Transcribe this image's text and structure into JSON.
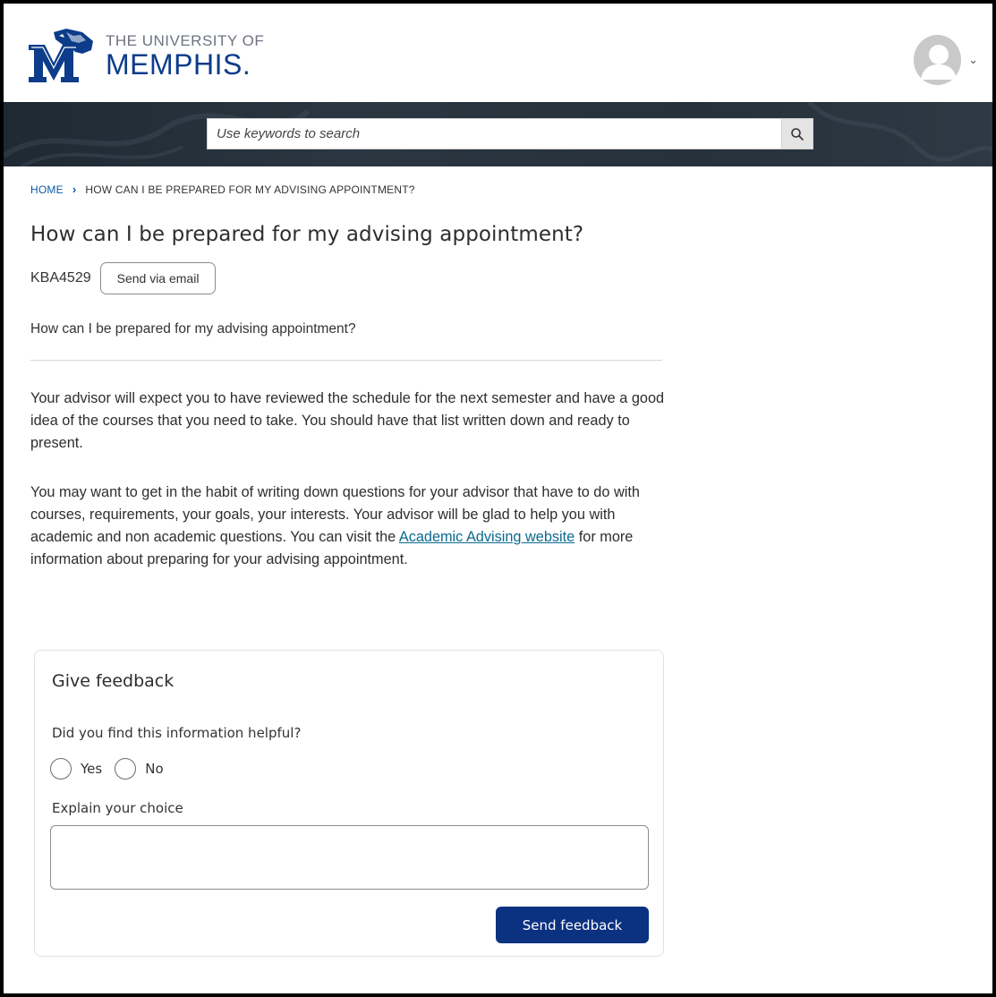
{
  "header": {
    "logo": {
      "line1": "THE UNIVERSITY OF",
      "line2": "MEMPHIS."
    },
    "avatar_icon": "user-avatar-icon",
    "menu_icon": "chevron-down-icon"
  },
  "search": {
    "placeholder": "Use keywords to search",
    "icon": "search-icon"
  },
  "breadcrumb": {
    "home": "HOME",
    "separator": "›",
    "current": "HOW CAN I BE PREPARED FOR MY ADVISING APPOINTMENT?"
  },
  "article": {
    "title": "How can I be prepared for my advising appointment?",
    "number": "KBA4529",
    "email_button": "Send via email",
    "subtitle": "How can I be prepared for my advising appointment?",
    "paragraph1": "Your advisor will expect you to have reviewed the schedule for the next semester and have a good idea of the courses that you need to take. You should have that list written down and ready to present.",
    "paragraph2_before": "You may want to get in the habit of writing down questions for your advisor that have to do with courses, requirements, your goals, your interests. Your advisor will be glad to help you with academic and non academic questions. You can visit the ",
    "paragraph2_link": "Academic Advising website",
    "paragraph2_after": " for more information about preparing for your advising appointment."
  },
  "feedback": {
    "title": "Give feedback",
    "question": "Did you find this information helpful?",
    "yes_label": "Yes",
    "no_label": "No",
    "explain_label": "Explain your choice",
    "textarea_value": "",
    "submit_label": "Send feedback"
  },
  "colors": {
    "brand_blue": "#0b3181",
    "logo_blue": "#0c3c8a",
    "link": "#0b6a8f",
    "banner": "#26313b"
  }
}
